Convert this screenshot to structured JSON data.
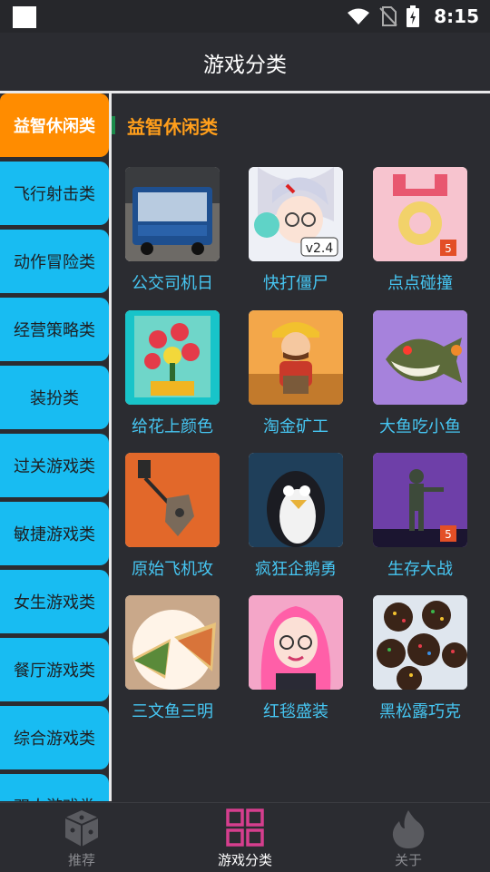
{
  "status": {
    "time": "8:15"
  },
  "header": {
    "title": "游戏分类"
  },
  "sidebar": {
    "items": [
      {
        "label": "益智休闲类"
      },
      {
        "label": "飞行射击类"
      },
      {
        "label": "动作冒险类"
      },
      {
        "label": "经营策略类"
      },
      {
        "label": "装扮类"
      },
      {
        "label": "过关游戏类"
      },
      {
        "label": "敏捷游戏类"
      },
      {
        "label": "女生游戏类"
      },
      {
        "label": "餐厅游戏类"
      },
      {
        "label": "综合游戏类"
      },
      {
        "label": "双人游戏类"
      }
    ]
  },
  "content": {
    "title": "益智休闲类",
    "games": [
      {
        "name": "公交司机日"
      },
      {
        "name": "快打僵尸"
      },
      {
        "name": "点点碰撞"
      },
      {
        "name": "给花上颜色"
      },
      {
        "name": "淘金矿工"
      },
      {
        "name": "大鱼吃小鱼"
      },
      {
        "name": "原始飞机攻"
      },
      {
        "name": "疯狂企鹅勇"
      },
      {
        "name": "生存大战"
      },
      {
        "name": "三文鱼三明"
      },
      {
        "name": "红毯盛装"
      },
      {
        "name": "黑松露巧克"
      }
    ]
  },
  "thumb_text": {
    "version": "v2.4",
    "html5": "5"
  },
  "bottom_nav": [
    {
      "label": "推荐",
      "icon": "dice-icon"
    },
    {
      "label": "游戏分类",
      "icon": "grid-icon"
    },
    {
      "label": "关于",
      "icon": "flame-icon"
    }
  ],
  "colors": {
    "accent": "#ff8c00",
    "sidebar": "#18bcf2",
    "game_label": "#46c6f2",
    "category_title": "#ff9e1b",
    "nav_active": "#d63e8e"
  }
}
